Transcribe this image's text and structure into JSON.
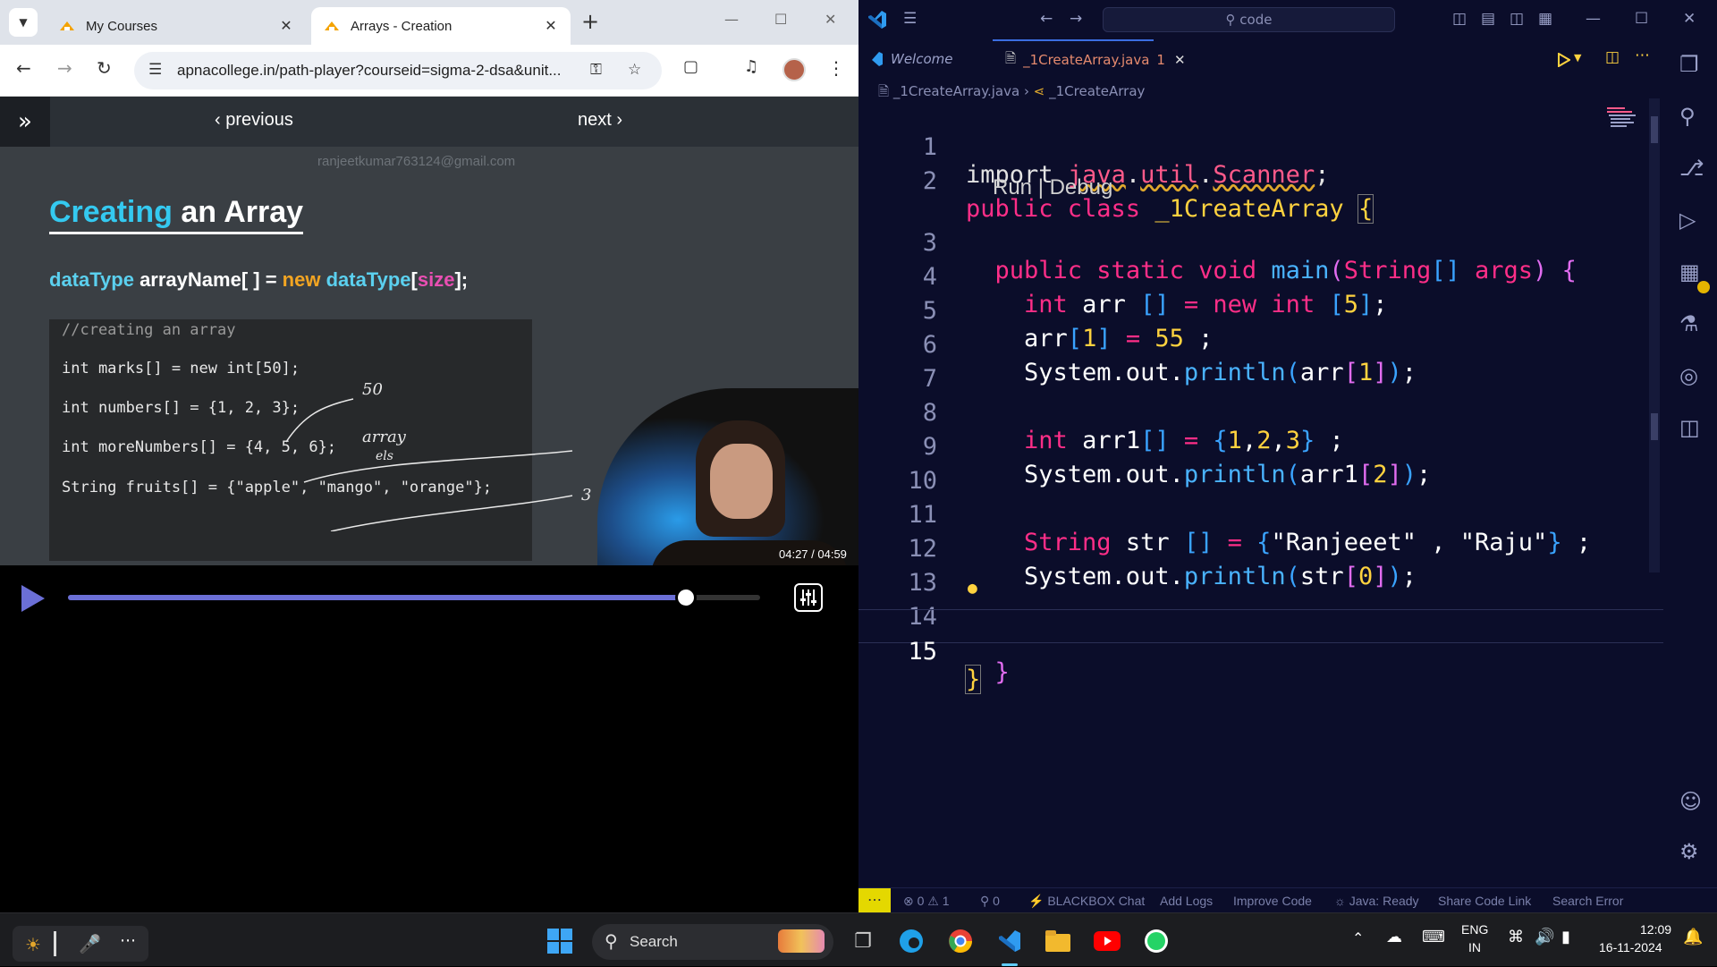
{
  "browser": {
    "tabs": [
      {
        "title": "My Courses",
        "active": false
      },
      {
        "title": "Arrays - Creation",
        "active": true
      }
    ],
    "url": "apnacollege.in/path-player?courseid=sigma-2-dsa&unit...",
    "player": {
      "prev_label": "previous",
      "next_label": "next",
      "watermark": "ranjeetkumar763124@gmail.com",
      "slide_title_part1": "Creating",
      "slide_title_part2": " an Array",
      "syntax_parts": [
        "dataType",
        " arrayName[ ] = ",
        "new",
        " dataType",
        "[",
        "size",
        "];"
      ],
      "code_lines": [
        {
          "text": "//creating an array"
        },
        {
          "text": "int marks[] = new int[50];"
        },
        {
          "text": "int numbers[] = {1, 2, 3};"
        },
        {
          "text": "int moreNumbers[] = {4, 5, 6};"
        },
        {
          "text": "String fruits[] = {\"apple\", \"mango\", \"orange\"};"
        }
      ],
      "annotations": [
        "50",
        "array",
        "els",
        "3",
        "3"
      ],
      "timestamp": "04:27 / 04:59",
      "progress": 0.893
    }
  },
  "vscode": {
    "search_placeholder": "code",
    "tabs": [
      {
        "label": "Welcome"
      },
      {
        "label": "_1CreateArray.java",
        "badge": "1"
      }
    ],
    "breadcrumb_file": "_1CreateArray.java",
    "breadcrumb_symbol": "_1CreateArray",
    "codelens": "Run | Debug",
    "line_numbers": [
      "1",
      "2",
      "3",
      "4",
      "5",
      "6",
      "7",
      "8",
      "9",
      "10",
      "11",
      "12",
      "13",
      "14",
      "15"
    ],
    "status": {
      "problems": "0 ⚠ 1",
      "ports": "0",
      "blackbox": "BLACKBOX Chat",
      "add_logs": "Add Logs",
      "improve_code": "Improve Code",
      "java": "Java: Ready",
      "share_code": "Share Code Link",
      "search_error": "Search Error"
    }
  },
  "taskbar": {
    "search_label": "Search",
    "lang_top": "ENG",
    "lang_bottom": "IN",
    "time": "12:09",
    "date": "16-11-2024"
  }
}
